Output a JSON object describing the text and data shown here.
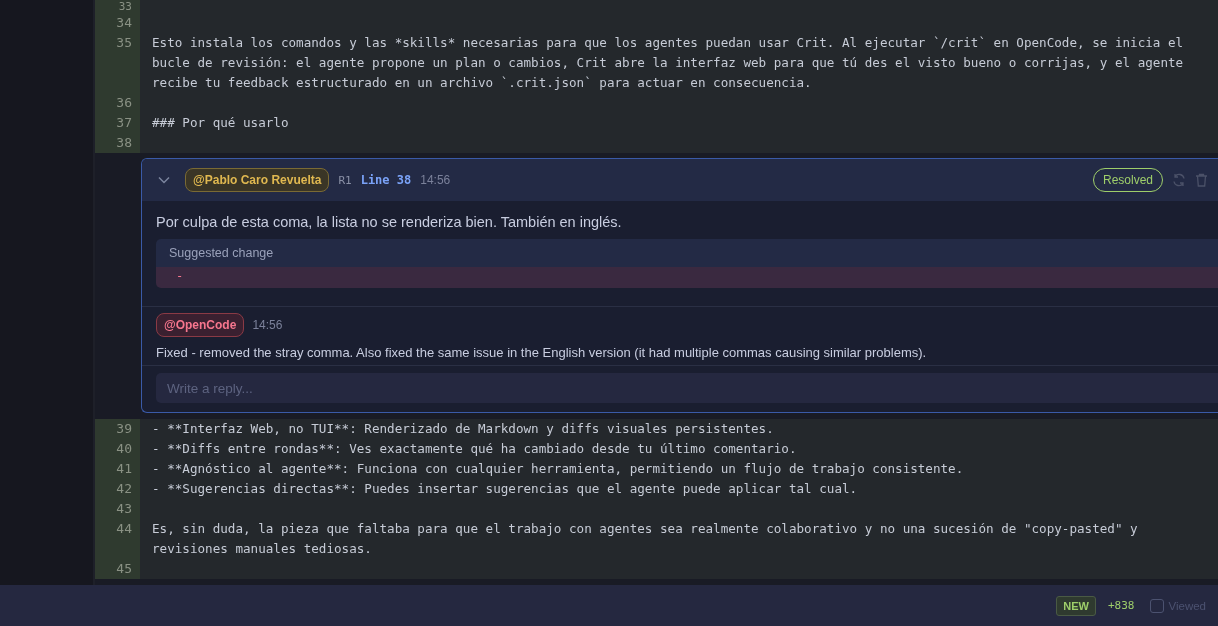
{
  "code_top": [
    {
      "number": "33"
    },
    {
      "number": "34"
    },
    {
      "number": "35",
      "lines": [
        "Esto instala los comandos y las *skills* necesarias para que los agentes puedan usar Crit. Al ejecutar `/crit` en OpenCode, se inicia el",
        "bucle de revisión: el agente propone un plan o cambios, Crit abre la interfaz web para que tú des el visto bueno o corrijas, y el agente",
        "recibe tu feedback estructurado en un archivo `.crit.json` para actuar en consecuencia."
      ]
    },
    {
      "number": "36"
    },
    {
      "number": "37",
      "lines": [
        "### Por qué usarlo"
      ]
    },
    {
      "number": "38"
    }
  ],
  "comment": {
    "expanded": true,
    "author": "@Pablo Caro Revuelta",
    "round": "R1",
    "line": "Line 38",
    "time": "14:56",
    "status": "Resolved",
    "body": "Por culpa de esta coma, la lista no se renderiza bien. También en inglés.",
    "suggestion": {
      "title": "Suggested change",
      "diff": [
        {
          "kind": "removed",
          "text": "-"
        }
      ]
    },
    "replies": [
      {
        "author": "@OpenCode",
        "time": "14:56",
        "text": "Fixed - removed the stray comma. Also fixed the same issue in the English version (it had multiple commas causing similar problems)."
      }
    ],
    "reply_field": {
      "placeholder": "Write a reply..."
    }
  },
  "code_bottom": [
    {
      "number": "39",
      "lines": [
        "- **Interfaz Web, no TUI**: Renderizado de Markdown y diffs visuales persistentes."
      ]
    },
    {
      "number": "40",
      "lines": [
        "- **Diffs entre rondas**: Ves exactamente qué ha cambiado desde tu último comentario."
      ]
    },
    {
      "number": "41",
      "lines": [
        "- **Agnóstico al agente**: Funciona con cualquier herramienta, permitiendo un flujo de trabajo consistente."
      ]
    },
    {
      "number": "42",
      "lines": [
        "- **Sugerencias directas**: Puedes insertar sugerencias que el agente puede aplicar tal cual."
      ]
    },
    {
      "number": "43"
    },
    {
      "number": "44",
      "lines": [
        "Es, sin duda, la pieza que faltaba para que el trabajo con agentes sea realmente colaborativo y no una sucesión de \"copy-pasted\" y",
        "revisiones manuales tediosas."
      ]
    },
    {
      "number": "45"
    }
  ],
  "footer": {
    "badge": "NEW",
    "additions": "+838",
    "viewed": {
      "label": "Viewed",
      "checked": false
    }
  }
}
